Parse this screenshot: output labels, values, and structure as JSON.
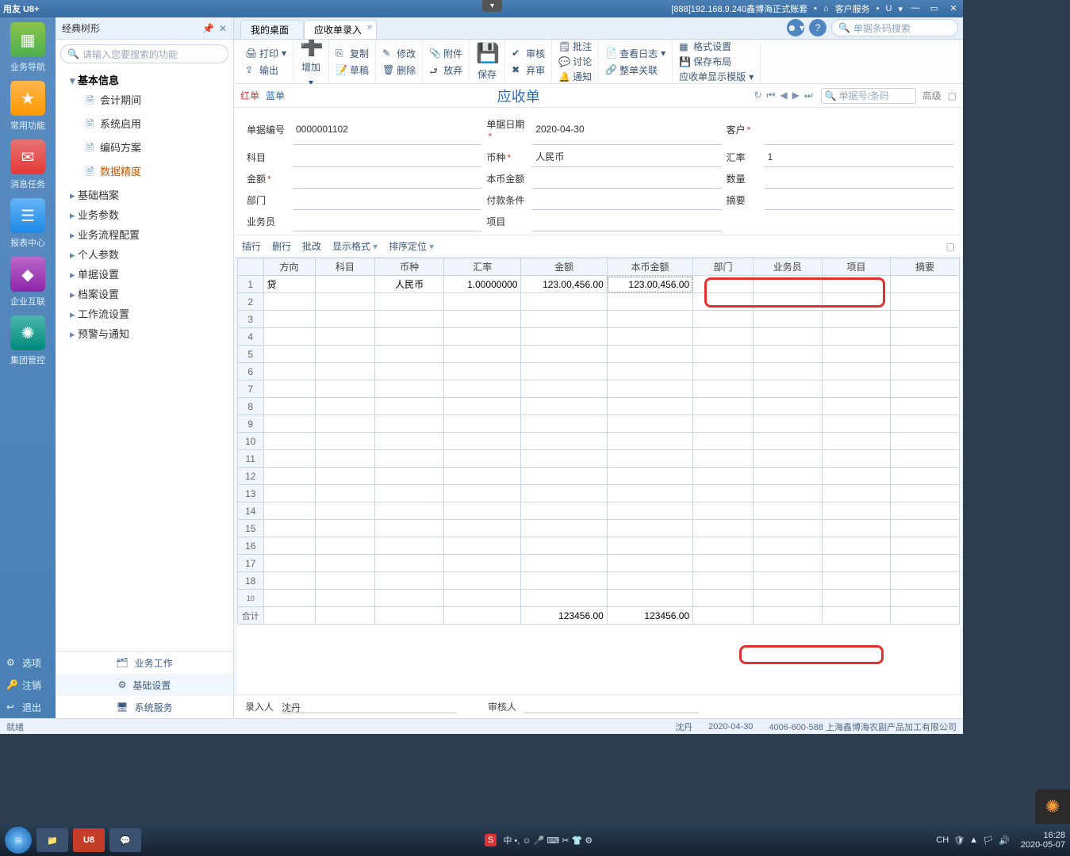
{
  "titlebar": {
    "logo": "用友 U8+",
    "conn": "[888]192.168.9.240鑫博海正式账套",
    "svc": "客户服务",
    "u_drop": "U"
  },
  "leftnav": {
    "items": [
      {
        "label": "业务导航"
      },
      {
        "label": "常用功能"
      },
      {
        "label": "消息任务"
      },
      {
        "label": "报表中心"
      },
      {
        "label": "企业互联"
      },
      {
        "label": "集团管控"
      }
    ],
    "bottom": [
      {
        "icon": "⚙",
        "label": "选项"
      },
      {
        "icon": "🔑",
        "label": "注销"
      },
      {
        "icon": "↩",
        "label": "退出"
      }
    ]
  },
  "tree": {
    "header": "经典树形",
    "search_ph": "请输入您要搜索的功能",
    "root": "基本信息",
    "children": [
      "会计期间",
      "系统启用",
      "编码方案",
      "数据精度"
    ],
    "siblings": [
      "基础档案",
      "业务参数",
      "业务流程配置",
      "个人参数",
      "单据设置",
      "档案设置",
      "工作流设置",
      "预警与通知"
    ],
    "bottom_tabs": [
      "业务工作",
      "基础设置",
      "系统服务"
    ]
  },
  "tabs": {
    "items": [
      {
        "label": "我的桌面",
        "close": false
      },
      {
        "label": "应收单录入",
        "close": true
      }
    ],
    "search_ph": "单据条码搜索"
  },
  "ribbon": {
    "g1a": "打印",
    "g1b": "输出",
    "g2": "增加",
    "g3a": "复制",
    "g3b": "草稿",
    "g4a": "修改",
    "g4b": "删除",
    "g5": "附件",
    "g5b": "放弃",
    "g6": "保存",
    "g7a": "审核",
    "g7b": "弃审",
    "g8a": "批注",
    "g8b": "讨论",
    "g8c": "通知",
    "g9a": "查看日志",
    "g9b": "整单关联",
    "g10a": "格式设置",
    "g10b": "保存布局",
    "g10c": "应收单显示模版"
  },
  "subhdr": {
    "red": "红单",
    "blue": "蓝单",
    "title": "应收单",
    "search_ph": "单据号/条码",
    "adv": "高级"
  },
  "form": {
    "l_billno": "单据编号",
    "v_billno": "0000001102",
    "l_date": "单据日期",
    "v_date": "2020-04-30",
    "l_cust": "客户",
    "l_acct": "科目",
    "l_cur": "币种",
    "v_cur": "人民币",
    "l_rate": "汇率",
    "v_rate": "1",
    "l_amt": "金额",
    "l_lamt": "本币金额",
    "l_qty": "数量",
    "l_dept": "部门",
    "l_pay": "付款条件",
    "l_memo": "摘要",
    "l_sales": "业务员",
    "l_proj": "项目"
  },
  "gridbar": {
    "b1": "插行",
    "b2": "删行",
    "b3": "批改",
    "b4": "显示格式",
    "b5": "排序定位"
  },
  "grid": {
    "headers": [
      "方向",
      "科目",
      "币种",
      "汇率",
      "金额",
      "本币金额",
      "部门",
      "业务员",
      "项目",
      "摘要"
    ],
    "row1": {
      "dir": "贷",
      "cur": "人民币",
      "rate": "1.00000000",
      "amt": "123.00,456.00",
      "lamt": "123.00,456.00"
    },
    "sum_label": "合计",
    "sum_amt": "123456.00",
    "sum_lamt": "123456.00"
  },
  "footer": {
    "l_entry": "录入人",
    "v_entry": "沈丹",
    "l_audit": "审核人"
  },
  "status": {
    "ready": "就绪",
    "user": "沈丹",
    "date": "2020-04-30",
    "tel": "4006-600-588 上海鑫博海农副产品加工有限公司"
  },
  "taskbar": {
    "ime": "中 •, ☺ 🎤 ⌨ ✂ 👕 ⚙",
    "tray": "CH",
    "time": "16:28",
    "date": "2020-05-07"
  }
}
